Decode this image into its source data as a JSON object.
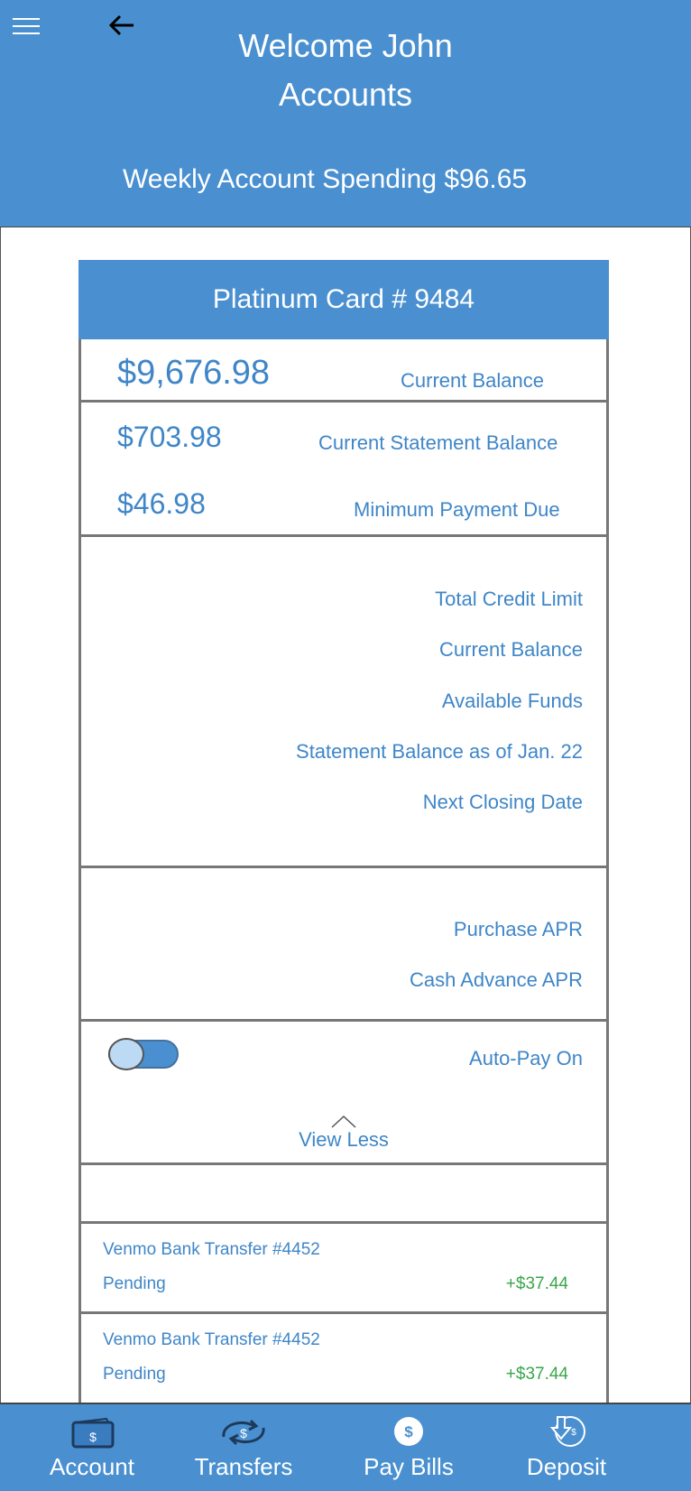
{
  "header": {
    "welcome": "Welcome John",
    "section": "Accounts",
    "spending": "Weekly Account Spending $96.65"
  },
  "card": {
    "title": "Platinum Card # 9484",
    "current_balance_value": "$9,676.98",
    "current_balance_label": "Current Balance",
    "statement_balance_value": "$703.98",
    "statement_balance_label": "Current Statement Balance",
    "minimum_payment_value": "$46.98",
    "minimum_payment_label": "Minimum Payment Due"
  },
  "details": {
    "total_credit_limit": "Total Credit Limit",
    "current_balance": "Current Balance",
    "available_funds": "Available Funds",
    "statement_balance_as_of": "Statement Balance as of Jan. 22",
    "next_closing_date": "Next Closing Date"
  },
  "apr": {
    "purchase": "Purchase APR",
    "cash_advance": "Cash Advance APR"
  },
  "autopay": {
    "label": "Auto-Pay On",
    "enabled": true
  },
  "view_less": "View Less",
  "transactions": [
    {
      "name": "Venmo Bank Transfer #4452",
      "status": "Pending",
      "amount": "+$37.44"
    },
    {
      "name": "Venmo Bank Transfer #4452",
      "status": "Pending",
      "amount": "+$37.44"
    }
  ],
  "nav": [
    {
      "label": "Account",
      "icon": "wallet-icon"
    },
    {
      "label": "Transfers",
      "icon": "transfer-icon"
    },
    {
      "label": "Pay Bills",
      "icon": "dollar-coin-icon"
    },
    {
      "label": "Deposit",
      "icon": "deposit-icon"
    }
  ],
  "colors": {
    "primary": "#4a90d0",
    "text_blue": "#3f86c8",
    "positive": "#3aa64a"
  }
}
